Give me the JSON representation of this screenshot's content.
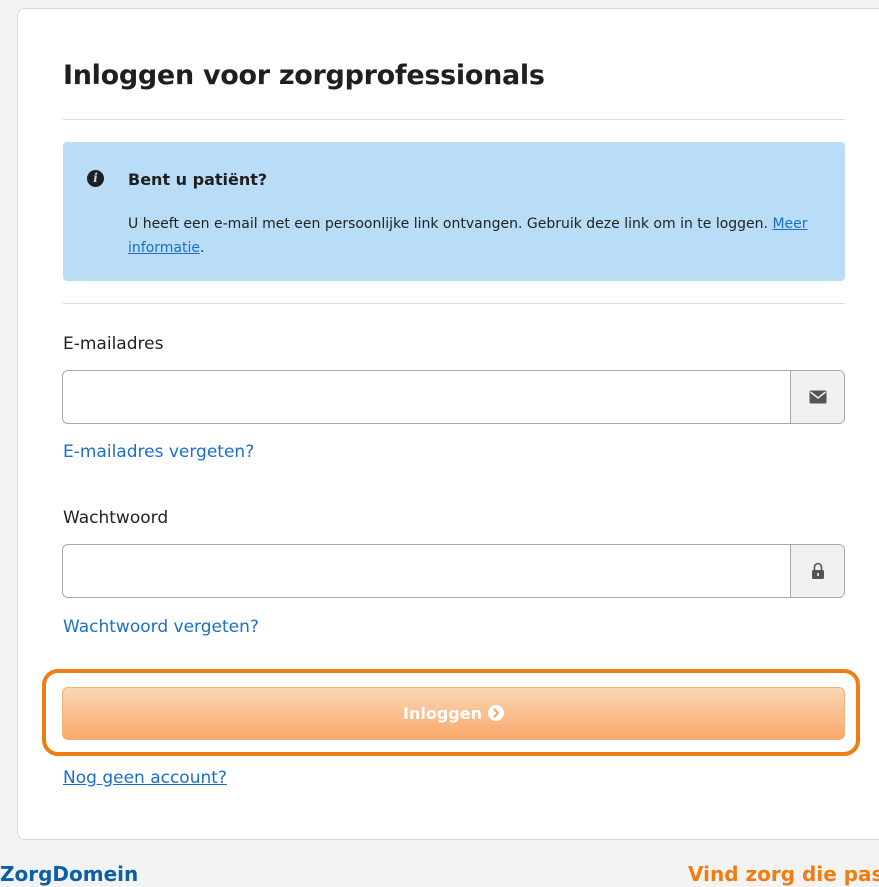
{
  "page": {
    "title": "Inloggen voor zorgprofessionals"
  },
  "info_box": {
    "icon": "info-circle-icon",
    "heading": "Bent u patiënt?",
    "body_text": "U heeft een e-mail met een persoonlijke link ontvangen. Gebruik deze link om in te loggen.",
    "link_label": "Meer informatie",
    "trailing": ".",
    "background_color": "#b9dcf7"
  },
  "email_field": {
    "label": "E-mailadres",
    "value": "",
    "placeholder": "",
    "icon": "envelope-icon",
    "forgot_link": "E-mailadres vergeten?"
  },
  "password_field": {
    "label": "Wachtwoord",
    "value": "",
    "placeholder": "",
    "icon": "lock-icon",
    "forgot_link": "Wachtwoord vergeten?"
  },
  "login_button": {
    "label": "Inloggen",
    "icon": "chevron-right-circle-icon",
    "color": "#f8a86a",
    "focus_ring_color": "#f07d12"
  },
  "register_link": "Nog geen account?",
  "footer": {
    "brand": "ZorgDomein",
    "slogan": "Vind zorg die pas",
    "brand_color": "#0b5fa5",
    "slogan_color": "#f07d12"
  },
  "colors": {
    "link": "#1b6fc8"
  }
}
